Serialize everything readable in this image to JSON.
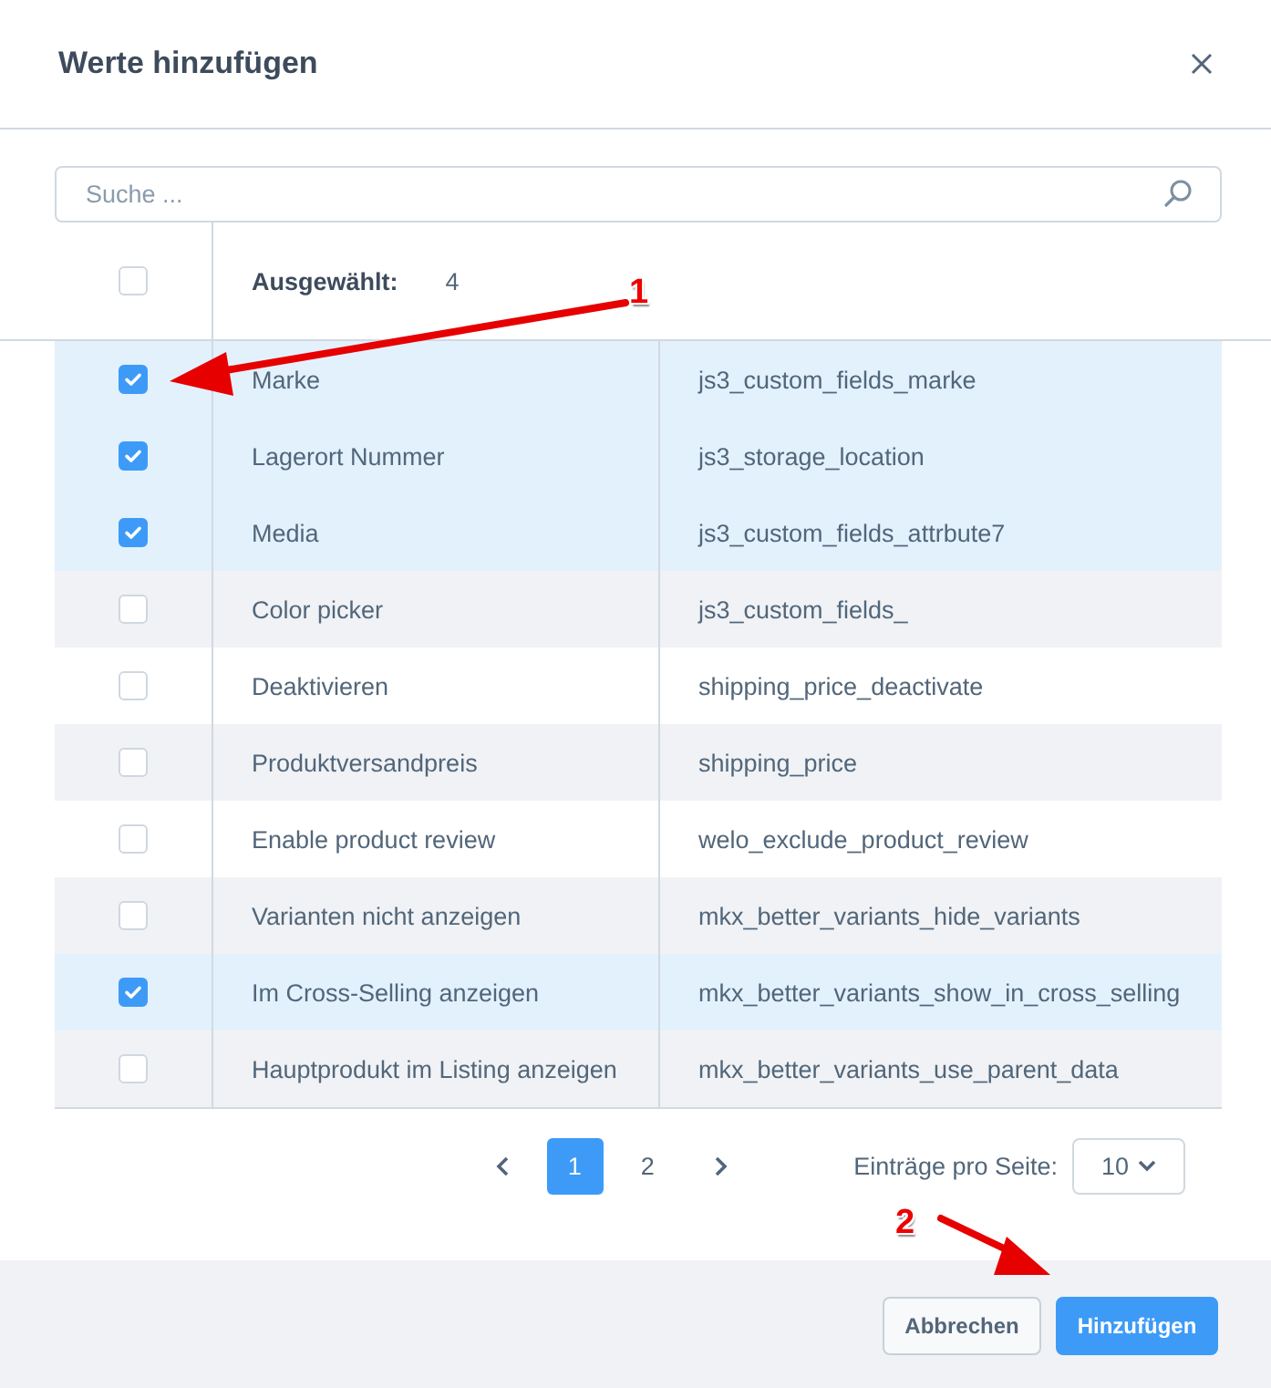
{
  "dialog": {
    "title": "Werte hinzufügen"
  },
  "search": {
    "placeholder": "Suche ..."
  },
  "table": {
    "header": {
      "select_all_checked": false,
      "selected_label": "Ausgewählt:",
      "selected_count": "4"
    },
    "rows": [
      {
        "name": "Marke",
        "technical_name": "js3_custom_fields_marke",
        "checked": true
      },
      {
        "name": "Lagerort Nummer",
        "technical_name": "js3_storage_location",
        "checked": true
      },
      {
        "name": "Media",
        "technical_name": "js3_custom_fields_attrbute7",
        "checked": true
      },
      {
        "name": "Color picker",
        "technical_name": "js3_custom_fields_",
        "checked": false
      },
      {
        "name": "Deaktivieren",
        "technical_name": "shipping_price_deactivate",
        "checked": false
      },
      {
        "name": "Produktversandpreis",
        "technical_name": "shipping_price",
        "checked": false
      },
      {
        "name": "Enable product review",
        "technical_name": "welo_exclude_product_review",
        "checked": false
      },
      {
        "name": "Varianten nicht anzeigen",
        "technical_name": "mkx_better_variants_hide_variants",
        "checked": false
      },
      {
        "name": "Im Cross-Selling anzeigen",
        "technical_name": "mkx_better_variants_show_in_cross_selling",
        "checked": true
      },
      {
        "name": "Hauptprodukt im Listing anzeigen",
        "technical_name": "mkx_better_variants_use_parent_data",
        "checked": false
      }
    ]
  },
  "pagination": {
    "pages": [
      {
        "label": "1",
        "selected": true
      },
      {
        "label": "2",
        "selected": false
      }
    ],
    "per_page_label": "Einträge pro Seite:",
    "per_page_value": "10"
  },
  "buttons": [
    {
      "label": "Abbrechen",
      "kind": "secondary"
    },
    {
      "label": "Hinzufügen",
      "kind": "primary"
    }
  ],
  "annotations": [
    {
      "label": "1"
    },
    {
      "label": "2"
    }
  ]
}
